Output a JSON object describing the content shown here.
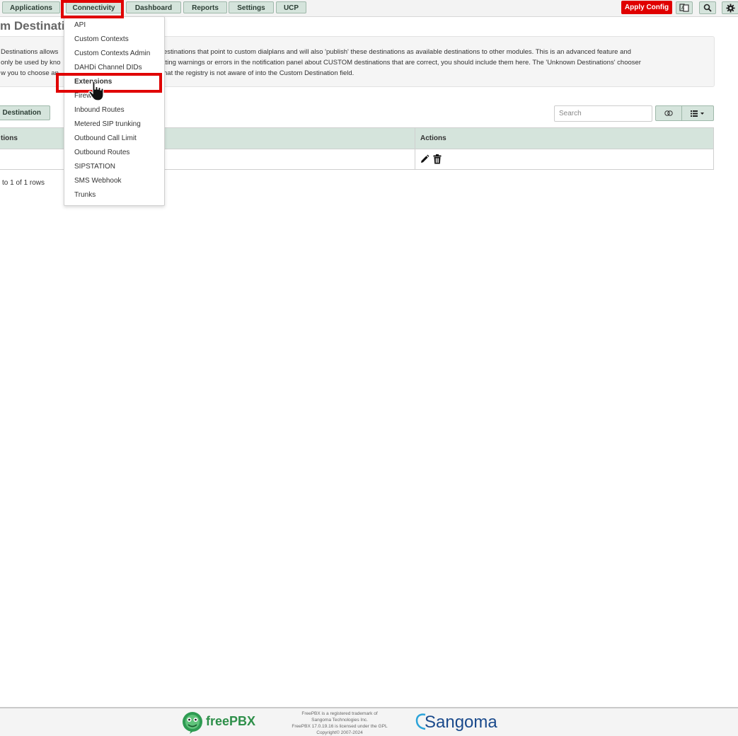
{
  "nav": {
    "items": [
      "Applications",
      "Connectivity",
      "Dashboard",
      "Reports",
      "Settings",
      "UCP"
    ],
    "apply_config": "Apply Config"
  },
  "icons": {
    "language": "language-icon",
    "search": "search-icon",
    "settings": "gear-icon"
  },
  "page": {
    "title": "m Destinatio",
    "info_lines": [
      "Destinations allows",
      "estinations that point to custom dialplans and will also 'publish' these destinations as available destinations to other modules. This is an advanced feature and",
      "only be used by kno",
      "tting warnings or errors in the notification panel about CUSTOM destinations that are correct, you should include them here. The 'Unknown Destinations' chooser",
      "w you to choose an",
      "hat the registry is not aware of into the Custom Destination field."
    ],
    "add_button": "Destination",
    "search_placeholder": "Search",
    "table": {
      "headers": [
        "tions",
        "Actions"
      ]
    },
    "pager": "to 1 of 1 rows"
  },
  "dropdown": {
    "items": [
      "API",
      "Custom Contexts",
      "Custom Contexts Admin",
      "DAHDi Channel DIDs",
      "Extensions",
      "Firew",
      "Inbound Routes",
      "Metered SIP trunking",
      "Outbound Call Limit",
      "Outbound Routes",
      "SIPSTATION",
      "SMS Webhook",
      "Trunks"
    ],
    "active_index": 4
  },
  "footer": {
    "freepbx_word": "freePBX",
    "lines": [
      "FreePBX is a registered trademark of",
      "Sangoma Technologies Inc.",
      "FreePBX 17.0.19.16 is licensed under the GPL",
      "Copyright© 2007-2024"
    ],
    "sangoma_word": "Sangoma"
  },
  "colors": {
    "nav_button": "#d5e4dc",
    "apply": "#e00000",
    "highlight": "#e00000"
  }
}
